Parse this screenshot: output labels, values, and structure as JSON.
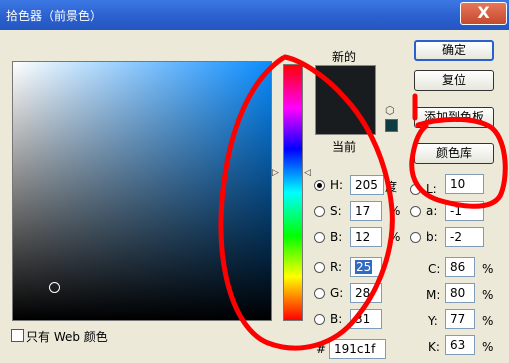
{
  "window": {
    "title": "拾色器（前景色）",
    "close_label": "X"
  },
  "swatches": {
    "new_label": "新的",
    "current_label": "当前",
    "new_color": "#191c1f",
    "current_color": "#191c1f",
    "websafe_color": "#0f3a40"
  },
  "buttons": {
    "ok": "确定",
    "reset": "复位",
    "add_to_swatches": "添加到色板",
    "color_libraries": "颜色库"
  },
  "hsb": {
    "h": {
      "label": "H:",
      "value": "205",
      "unit": "度"
    },
    "s": {
      "label": "S:",
      "value": "17",
      "unit": "%"
    },
    "b": {
      "label": "B:",
      "value": "12",
      "unit": "%"
    }
  },
  "rgb": {
    "r": {
      "label": "R:",
      "value": "25"
    },
    "g": {
      "label": "G:",
      "value": "28"
    },
    "b": {
      "label": "B:",
      "value": "31"
    }
  },
  "lab": {
    "l": {
      "label": "L:",
      "value": "10"
    },
    "a": {
      "label": "a:",
      "value": "-1"
    },
    "b": {
      "label": "b:",
      "value": "-2"
    }
  },
  "cmyk": {
    "c": {
      "label": "C:",
      "value": "86",
      "unit": "%"
    },
    "m": {
      "label": "M:",
      "value": "80",
      "unit": "%"
    },
    "y": {
      "label": "Y:",
      "value": "77",
      "unit": "%"
    },
    "k": {
      "label": "K:",
      "value": "63",
      "unit": "%"
    }
  },
  "hex": {
    "label": "#",
    "value": "191c1f"
  },
  "web_only": {
    "label": "只有 Web 颜色",
    "checked": false
  },
  "colors": {
    "title_bar": "#2a5fcd",
    "annotation": "#ff0000",
    "field_hue": "#0a8cff"
  }
}
